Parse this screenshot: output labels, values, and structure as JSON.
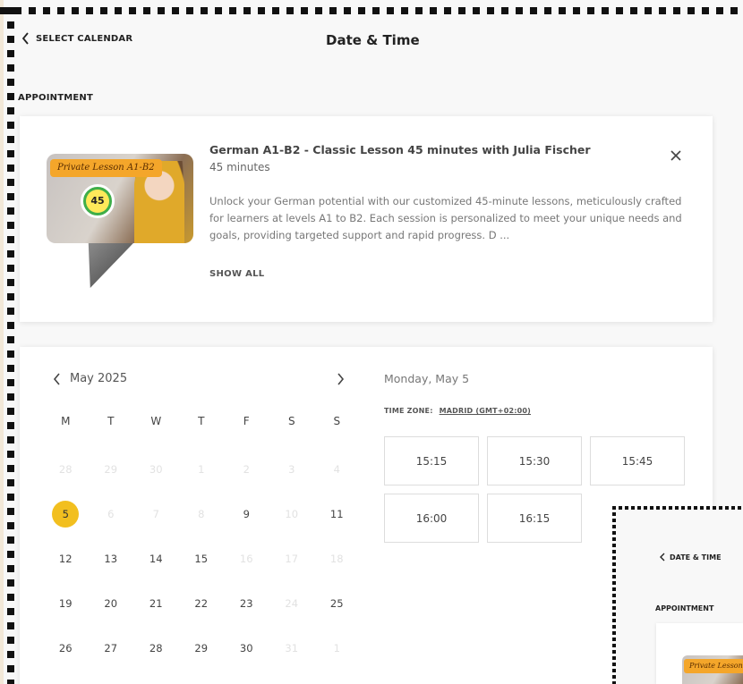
{
  "header": {
    "back_label": "SELECT CALENDAR",
    "title": "Date & Time"
  },
  "appointment": {
    "section_label": "APPOINTMENT",
    "thumb_badge": "Private Lesson A1-B2",
    "thumb_clock": "45",
    "title": "German A1-B2 - Classic Lesson 45 minutes with Julia Fischer",
    "duration": "45 minutes",
    "description": "Unlock your German potential with our customized 45-minute lessons, meticulously crafted for learners at levels A1 to B2. Each session is personalized to meet your unique needs and goals, providing targeted support and rapid progress. D ...",
    "show_all": "SHOW ALL"
  },
  "calendar": {
    "month_label": "May 2025",
    "weekdays": [
      "M",
      "T",
      "W",
      "T",
      "F",
      "S",
      "S"
    ],
    "weeks": [
      [
        {
          "d": "28",
          "s": "muted"
        },
        {
          "d": "29",
          "s": "muted"
        },
        {
          "d": "30",
          "s": "muted"
        },
        {
          "d": "1",
          "s": "muted"
        },
        {
          "d": "2",
          "s": "muted"
        },
        {
          "d": "3",
          "s": "muted"
        },
        {
          "d": "4",
          "s": "muted"
        }
      ],
      [
        {
          "d": "5",
          "s": "selected"
        },
        {
          "d": "6",
          "s": "muted"
        },
        {
          "d": "7",
          "s": "muted"
        },
        {
          "d": "8",
          "s": "muted"
        },
        {
          "d": "9",
          "s": "active"
        },
        {
          "d": "10",
          "s": "muted"
        },
        {
          "d": "11",
          "s": "active"
        }
      ],
      [
        {
          "d": "12",
          "s": "active"
        },
        {
          "d": "13",
          "s": "active"
        },
        {
          "d": "14",
          "s": "active"
        },
        {
          "d": "15",
          "s": "active"
        },
        {
          "d": "16",
          "s": "muted"
        },
        {
          "d": "17",
          "s": "muted"
        },
        {
          "d": "18",
          "s": "muted"
        }
      ],
      [
        {
          "d": "19",
          "s": "active"
        },
        {
          "d": "20",
          "s": "active"
        },
        {
          "d": "21",
          "s": "active"
        },
        {
          "d": "22",
          "s": "active"
        },
        {
          "d": "23",
          "s": "active"
        },
        {
          "d": "24",
          "s": "muted"
        },
        {
          "d": "25",
          "s": "active"
        }
      ],
      [
        {
          "d": "26",
          "s": "active"
        },
        {
          "d": "27",
          "s": "active"
        },
        {
          "d": "28",
          "s": "active"
        },
        {
          "d": "29",
          "s": "active"
        },
        {
          "d": "30",
          "s": "active"
        },
        {
          "d": "31",
          "s": "muted"
        },
        {
          "d": "1",
          "s": "muted"
        }
      ]
    ],
    "selected_accent": "#f2bf1f"
  },
  "times": {
    "selected_date": "Monday, May 5",
    "timezone_label": "TIME ZONE:",
    "timezone_value": "MADRID (GMT+02:00)",
    "slots": [
      "15:15",
      "15:30",
      "15:45",
      "16:00",
      "16:15"
    ]
  },
  "overlay": {
    "back_label": "DATE & TIME",
    "section_label": "APPOINTMENT",
    "thumb_badge": "Private Lesson"
  }
}
